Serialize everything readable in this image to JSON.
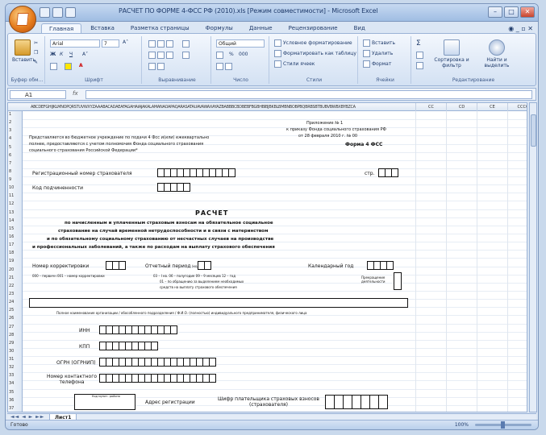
{
  "window": {
    "title": "РАСЧЕТ ПО ФОРМЕ 4-ФСС РФ (2010).xls [Режим совместимости] - Microsoft Excel",
    "min": "–",
    "max": "□",
    "close": "✕"
  },
  "ribbon": {
    "tabs": [
      "Главная",
      "Вставка",
      "Разметка страницы",
      "Формулы",
      "Данные",
      "Рецензирование",
      "Вид"
    ],
    "active_tab": "Главная",
    "help": "◉ _ ▫ ✕",
    "clipboard": {
      "paste": "Вставить",
      "group": "Буфер обм…"
    },
    "font": {
      "name": "Arial",
      "size": "7",
      "group": "Шрифт",
      "bold": "Ж",
      "italic": "К",
      "underline": "Ч",
      "grow": "A˄",
      "shrink": "A˅"
    },
    "alignment": {
      "group": "Выравнивание"
    },
    "number": {
      "format": "Общий",
      "group": "Число",
      "percent": "%",
      "thousands": "000"
    },
    "styles": {
      "conditional": "Условное форматирование",
      "table": "Форматировать как таблицу",
      "cell": "Стили ячеек",
      "group": "Стили"
    },
    "cells": {
      "insert": "Вставить",
      "delete": "Удалить",
      "format": "Формат",
      "group": "Ячейки"
    },
    "editing": {
      "sort": "Сортировка и фильтр",
      "find": "Найти и выделить",
      "group": "Редактирование",
      "sum": "Σ"
    }
  },
  "formula_bar": {
    "cell": "A1",
    "fx": "fx",
    "value": ""
  },
  "grid": {
    "col_letters": "ABCDEFGHIJKLMNOPQRSTUVWXYZAAABACADAEAFAGAHAIAJAKALAMANAOAPAQARASATAUAVAWAXAYAZBABBBCBDBEBFBGBHBIBJBKBLBMBNBOBPBQBRBSBTBUBVBWBXBYBZCA",
    "col_extra": [
      "CC",
      "CD",
      "CE",
      "CCCC"
    ],
    "rows": [
      "1",
      "2",
      "3",
      "4",
      "5",
      "6",
      "7",
      "8",
      "9",
      "10",
      "11",
      "12",
      "13",
      "14",
      "15",
      "16",
      "17",
      "18",
      "19",
      "20",
      "21",
      "22",
      "23",
      "24",
      "25",
      "26",
      "27",
      "28",
      "29",
      "30",
      "31",
      "32",
      "33",
      "34",
      "35",
      "36",
      "37"
    ]
  },
  "form": {
    "appendix": "Приложение № 1",
    "appendix_line2": "к приказу Фонда социального страхования РФ",
    "appendix_line3": "от 28 февраля 2010 г. № 00",
    "form_name": "Форма 4 ФСС",
    "submitted": "Представляется во бюджетное учреждение по подачи 4 Фсс и(или) ежеквартально",
    "submitted2": "полнее, предоставляются с учетом полномочия Фонда социального страхования",
    "submitted3": "социального страхования Российской Федерации*",
    "reg_number_label": "Регистрационный номер страхователя",
    "kpp_label": "стр.",
    "subordination_label": "Код подчиненности",
    "heading": "РАСЧЕТ",
    "subheading_lines": [
      "по начисленным и уплаченным страховым взносам на обязательное социальное",
      "страхование на случай временной нетрудоспособности и в связи с материнством",
      "и по обязательному социальному страхованию от несчастных случаев на производстве",
      "и профессиональных заболеваний, а также по расходам на выплату страхового обеспечения"
    ],
    "correction_label": "Номер корректировки",
    "period_label": "Отчетный период",
    "period_code": "(код)",
    "calendar_year_label": "Календарный год",
    "correction_hint": "000 – первичн 001 – номер корректировки",
    "period_hint": "03 – I кв. 06 – полугодие 09 – 9 месяцев 12 – год",
    "period_hint2": "01 – по обращению за выделением необходимых",
    "period_hint3": "средств на выплату страхового обеспечения",
    "cease_label": "Прекращение деятельности",
    "name_hint": "Полное наименование организации / обособленного подразделения / Ф.И.О. (полностью) индивидуального предпринимателя, физического лица",
    "inn_label": "ИНН",
    "kpp2_label": "КПП",
    "ogrn_label": "ОГРН (ОГРНИП)",
    "phone_label": "Номер контактного телефона",
    "address_label": "Адрес регистрации",
    "reg_hint": "Код мунит. района",
    "payer_code_label": "Шифр плательщика страховых взносов (страхователя)"
  },
  "sheets": {
    "nav": "◄◄ ◄ ► ►►",
    "active": "Лист1"
  },
  "status": {
    "ready": "Готово",
    "zoom": "100%"
  }
}
